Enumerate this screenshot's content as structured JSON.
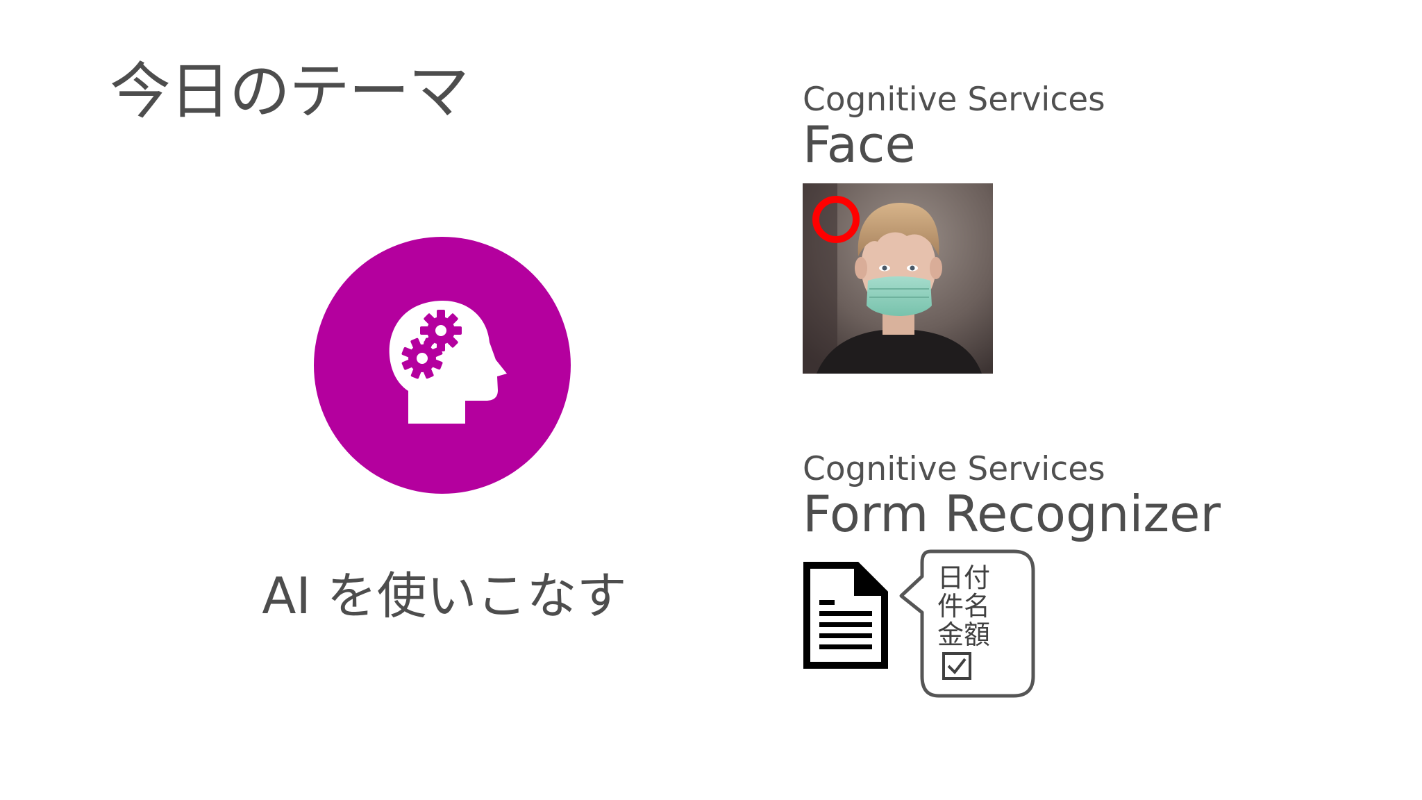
{
  "slide": {
    "title": "今日のテーマ",
    "tagline": "AI を使いこなす",
    "accent_color": "#b4009e",
    "hero_icon": "head-with-gears-icon"
  },
  "face_section": {
    "kicker": "Cognitive Services",
    "title": "Face",
    "photo": {
      "subject": "boy-wearing-face-mask",
      "marker_color": "#ff0000"
    }
  },
  "form_section": {
    "kicker": "Cognitive Services",
    "title": "Form Recognizer",
    "document_icon": "document-icon",
    "extracted_fields": [
      "日付",
      "件名",
      "金額"
    ],
    "checkbox_icon": "checked-box-icon"
  }
}
